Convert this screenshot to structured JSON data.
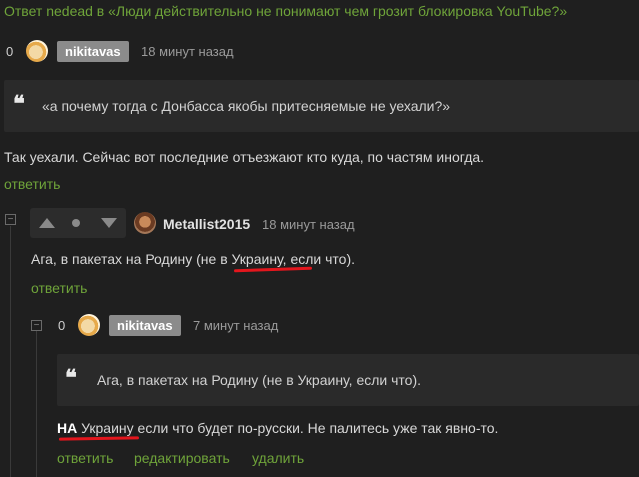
{
  "header": {
    "reply_prefix": "Ответ nedead в ",
    "post_title": "«Люди действительно не понимают чем грозит блокировка YouTube?»"
  },
  "comment1": {
    "rating": "0",
    "user": "nikitavas",
    "time": "18 минут назад",
    "quote": "«а почему тогда с Донбасса якобы притесняемые не уехали?»",
    "body": "Так уехали. Сейчас вот последние отъезжают кто куда, по частям иногда.",
    "reply": "ответить"
  },
  "comment2": {
    "collapse": "−",
    "user": "Metallist2015",
    "time": "18 минут назад",
    "body_before": "Ага, в пакетах на Родину (не ",
    "body_highlight": "в Украину",
    "body_after": ", если что).",
    "reply": "ответить"
  },
  "comment3": {
    "collapse": "−",
    "rating": "0",
    "user": "nikitavas",
    "time": "7 минут назад",
    "quote": "Ага, в пакетах на Родину (не в Украину, если что).",
    "body_bold": "НА",
    "body_underlined": "Украину",
    "body_rest": " если что будет по-русски. Не палитесь уже так явно-то.",
    "actions": {
      "reply": "ответить",
      "edit": "редактировать",
      "delete": "удалить"
    }
  },
  "colors": {
    "link": "#6fa43a",
    "highlight": "#e3161d",
    "background": "#1f1f1f"
  },
  "icons": [
    "quote-icon",
    "upvote-icon",
    "downvote-icon",
    "collapse-icon",
    "avatar"
  ]
}
